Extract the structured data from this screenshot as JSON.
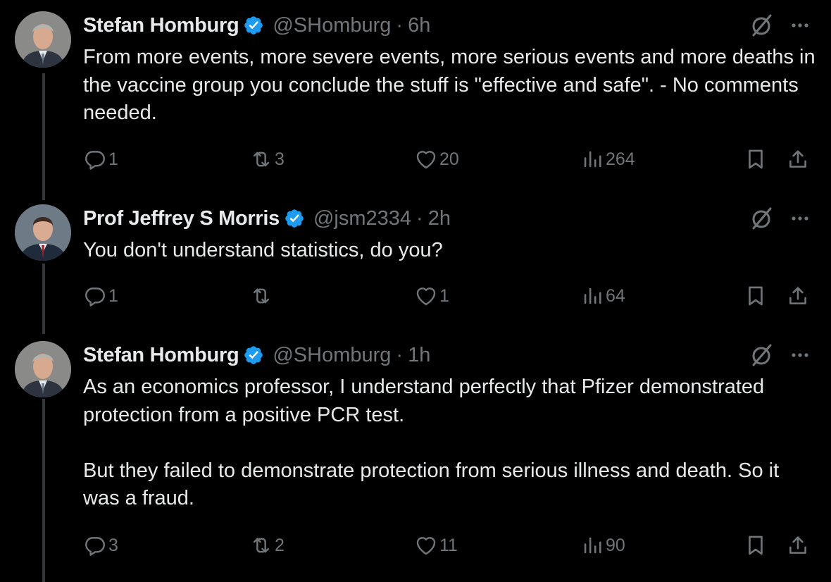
{
  "colors": {
    "background": "#000000",
    "text_primary": "#e7e9ea",
    "text_secondary": "#71767b",
    "verified_blue": "#1d9bf0",
    "thread_line": "#333639"
  },
  "tweets": [
    {
      "name": "Stefan Homburg",
      "handle": "@SHomburg",
      "separator": "·",
      "time": "6h",
      "text": "From more events, more severe events, more serious events and more deaths in the vaccine group you conclude the stuff is \"effective and safe\". - No comments needed.",
      "replies": "1",
      "retweets": "3",
      "likes": "20",
      "views": "264"
    },
    {
      "name": "Prof Jeffrey S Morris",
      "handle": "@jsm2334",
      "separator": "·",
      "time": "2h",
      "text": "You don't understand statistics, do you?",
      "replies": "1",
      "retweets": "",
      "likes": "1",
      "views": "64"
    },
    {
      "name": "Stefan Homburg",
      "handle": "@SHomburg",
      "separator": "·",
      "time": "1h",
      "text": "As an economics professor, I understand perfectly that Pfizer demonstrated protection from a positive PCR test.\n\nBut they failed to demonstrate protection from serious illness and death. So it was a fraud.",
      "replies": "3",
      "retweets": "2",
      "likes": "11",
      "views": "90"
    }
  ],
  "icons": {
    "verified": "verified-badge-icon",
    "grok": "grok-icon",
    "more": "more-dots-icon",
    "reply": "reply-icon",
    "retweet": "retweet-icon",
    "like": "heart-icon",
    "views": "views-chart-icon",
    "bookmark": "bookmark-icon",
    "share": "share-icon"
  }
}
